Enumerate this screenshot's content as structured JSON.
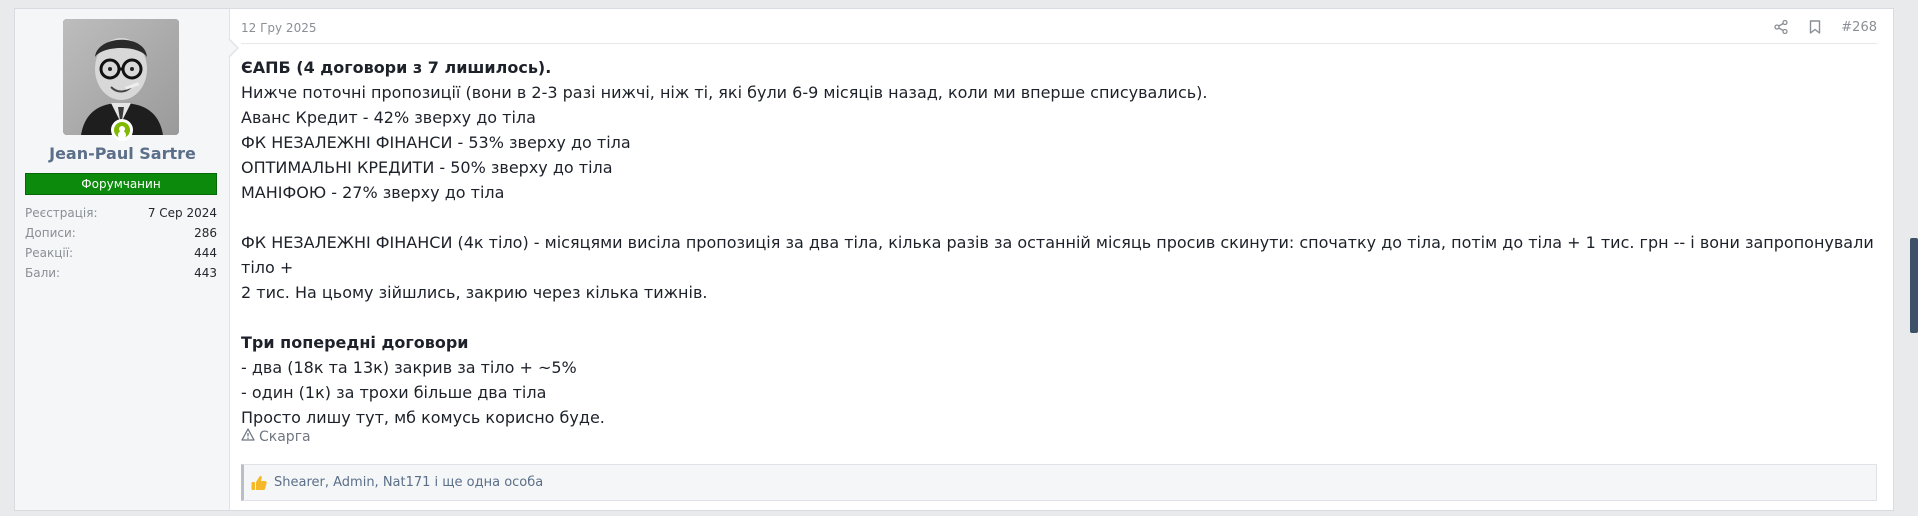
{
  "user": {
    "name": "Jean-Paul Sartre",
    "title": "Форумчанин",
    "title_color": "#0b8a0b",
    "online": true,
    "stats": [
      {
        "label": "Реєстрація:",
        "value": "7 Сер 2024"
      },
      {
        "label": "Дописи:",
        "value": "286"
      },
      {
        "label": "Реакції:",
        "value": "444"
      },
      {
        "label": "Бали:",
        "value": "443"
      }
    ]
  },
  "post": {
    "date": "12 Гру 2025",
    "number": "#268",
    "lines": [
      {
        "text": "ЄАПБ (4 договори з 7 лишилось).",
        "bold": true
      },
      {
        "text": "Нижче поточні пропозиції (вони в 2-3 разі нижчі, ніж ті, які були 6-9 місяців назад, коли ми вперше списувались)."
      },
      {
        "text": "Аванс Кредит - 42% зверху до тіла"
      },
      {
        "text": "ФК НЕЗАЛЕЖНІ ФІНАНСИ - 53% зверху до тіла"
      },
      {
        "text": "ОПТИМАЛЬНІ КРЕДИТИ - 50% зверху до тіла"
      },
      {
        "text": "МАНІФОЮ - 27% зверху до тіла"
      },
      {
        "text": ""
      },
      {
        "text": "ФК НЕЗАЛЕЖНІ ФІНАНСИ (4к тіло) - місяцями висіла пропозиція за два тіла, кілька разів за останній місяць просив скинути: спочатку до тіла, потім до тіла + 1 тис. грн -- і вони запропонували тіло +"
      },
      {
        "text": "2 тис. На цьому зійшлись, закрию через кілька тижнів."
      },
      {
        "text": ""
      },
      {
        "text": "Три попередні договори",
        "bold": true
      },
      {
        "text": "- два (18к та 13к) закрив за тіло + ~5%"
      },
      {
        "text": "- один (1к) за трохи більше два тіла"
      },
      {
        "text": "Просто лишу тут, мб комусь корисно буде."
      }
    ],
    "report_label": "Скарга",
    "reactions_text": "Shearer, Admin, Nat171 і ще одна особа"
  },
  "colors": {
    "accent": "#5b6f89",
    "online": "#7fb900",
    "scroll_thumb": "#3d5168"
  }
}
